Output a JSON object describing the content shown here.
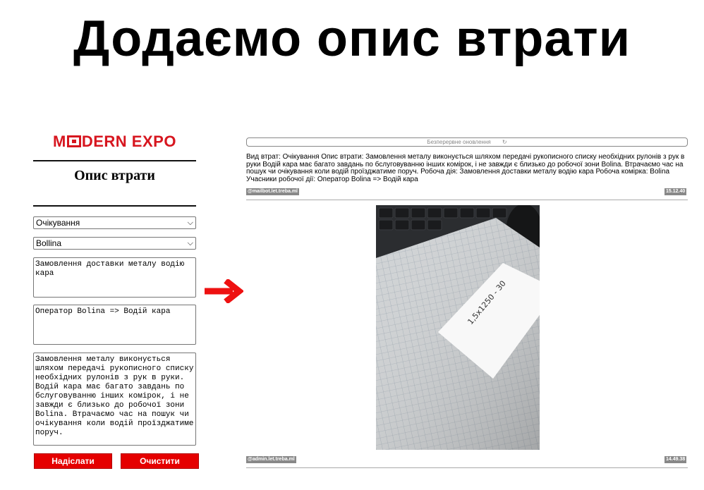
{
  "slide": {
    "title": "Додаємо  опис втрати"
  },
  "logo": {
    "part1": "M",
    "part2": "DERN EXPO"
  },
  "form": {
    "title": "Опис втрати",
    "loss_type_value": "Очікування",
    "workplace_value": "Bollina",
    "action_text": "Замовлення доставки металу водію кара",
    "participants_text": "Оператор Bolina => Водій кара",
    "description_text": "Замовлення металу виконується шляхом передачі рукописного списку необхідних рулонів з рук в руки. Водій кара має багато завдань по бслуговуванню інших комірок, і не завжди є близько до робочої зони Bolina. Втрачаємо час на пошук чи очікування коли водій проїзджатиме поруч.",
    "submit_label": "Надіслати",
    "clear_label": "Очистити"
  },
  "chat": {
    "refresh_label": "Безперервне оновлення",
    "message_text": "Вид втрат: Очікування Опис втрати: Замовлення металу виконується шляхом передачі рукописного списку необхідних рулонів з рук в руки Водій кара має багато завдань по бслуговуванню інших комірок, і не завжди є близько до робочої зони Bolina. Втрачаємо час на пошук чи очікування коли водій проїзджатиме поруч. Робоча дія: Замовлення доставки металу водію кара Робоча комірка: Bolina Учасники робочої дії: Оператор Bolina => Водій кара",
    "message1_author": "@mailbot.let.treba.ml",
    "message1_time": "15.12.40",
    "message2_author": "@admin.let.treba.ml",
    "message2_time": "14.49.38",
    "photo_note": "1,5х1250 - 30"
  },
  "colors": {
    "brand_red": "#d7161f",
    "button_red": "#e50000",
    "arrow_red": "#ee1111",
    "tag_gray": "#888888"
  },
  "icons": {
    "refresh": "refresh-icon",
    "dropdown": "chevron-down-icon",
    "arrow": "arrow-right-icon"
  }
}
